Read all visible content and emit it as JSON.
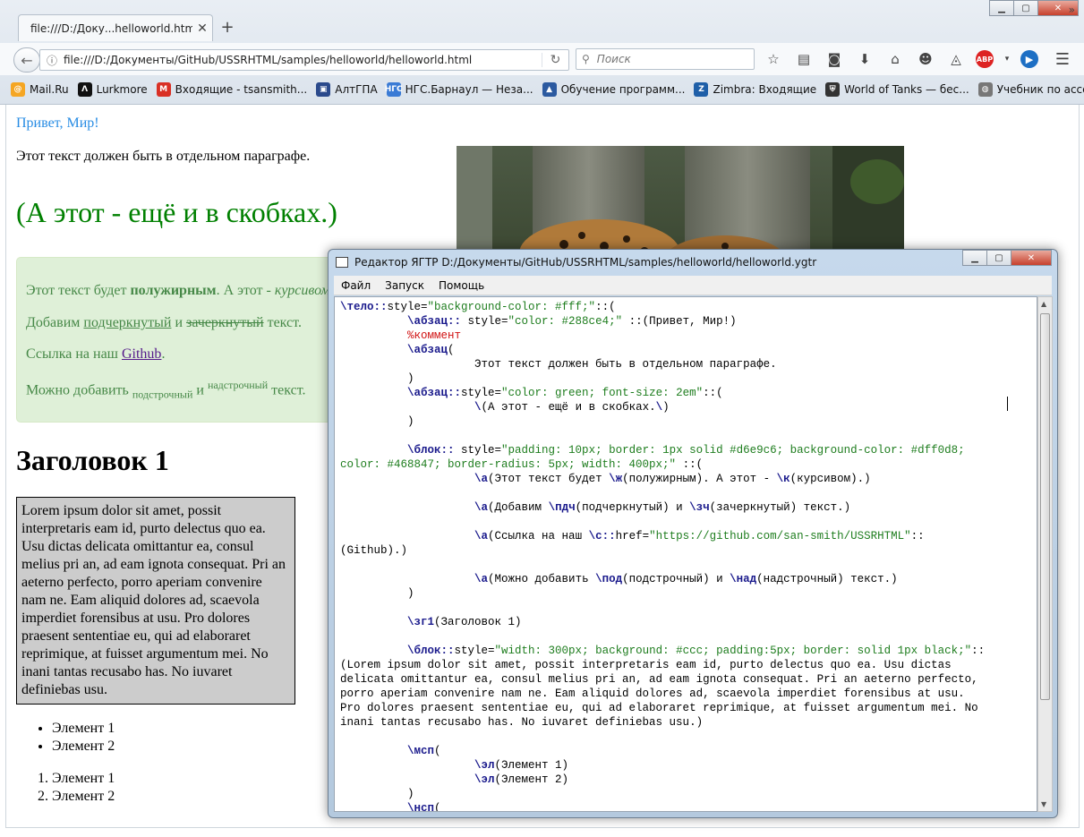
{
  "browser": {
    "tab_title": "file:///D:/Доку...helloworld.html",
    "tab_close": "✕",
    "new_tab": "+",
    "url": "file:///D:/Документы/GitHub/USSRHTML/samples/helloworld/helloworld.html",
    "search_placeholder": "Поиск",
    "window_controls": {
      "minimize": "▁",
      "maximize": "▢",
      "close": "✕"
    },
    "bookmarks": [
      {
        "label": "Mail.Ru",
        "icon": "mailru-icon",
        "color": "#f5a623",
        "glyph": "@"
      },
      {
        "label": "Lurkmore",
        "icon": "lurkmore-icon",
        "color": "#111111",
        "glyph": "Λ"
      },
      {
        "label": "Входящие - tsansmith...",
        "icon": "gmail-icon",
        "color": "#d93025",
        "glyph": "M"
      },
      {
        "label": "АлтГПА",
        "icon": "altgpa-icon",
        "color": "#2b4a8c",
        "glyph": "▣"
      },
      {
        "label": "НГС.Барнаул — Неза...",
        "icon": "ngs-icon",
        "color": "#3a7bd5",
        "glyph": "НГС"
      },
      {
        "label": "Обучение программ...",
        "icon": "obuchenie-icon",
        "color": "#2c5aa0",
        "glyph": "▲"
      },
      {
        "label": "Zimbra: Входящие",
        "icon": "zimbra-icon",
        "color": "#1f5fa8",
        "glyph": "Z"
      },
      {
        "label": "World of Tanks — бес...",
        "icon": "wot-icon",
        "color": "#333333",
        "glyph": "⛨"
      },
      {
        "label": "Учебник по ассембле...",
        "icon": "globe-icon",
        "color": "#777777",
        "glyph": "◍"
      }
    ],
    "bookmarks_more": "»"
  },
  "page": {
    "p1": "Привет, Мир!",
    "p2": "Этот текст должен быть в отдельном параграфе.",
    "p3": "(А этот - ещё и в скобках.)",
    "box": {
      "l1_a": "Этот текст будет ",
      "l1_bold": "полужирным",
      "l1_b": ". А этот - ",
      "l1_italic": "курсивом",
      "l2_a": "Добавим ",
      "l2_u": "подчеркнутый",
      "l2_b": " и ",
      "l2_s": "зачеркнутый",
      "l2_c": " текст.",
      "l3_a": "Ссылка на наш ",
      "l3_link": "Github",
      "l3_b": ".",
      "l4_a": "Можно добавить ",
      "l4_sub": "подстрочный",
      "l4_b": " и ",
      "l4_sup": "надстрочный",
      "l4_c": " текст."
    },
    "heading1": "Заголовок 1",
    "lorem": "Lorem ipsum dolor sit amet, possit interpretaris eam id, purto delectus quo ea. Usu dictas delicata omittantur ea, consul melius pri an, ad eam ignota consequat. Pri an aeterno perfecto, porro aperiam convenire nam ne. Eam aliquid dolores ad, scaevola imperdiet forensibus at usu. Pro dolores praesent sententiae eu, qui ad elaboraret reprimique, at fuisset argumentum mei. No inani tantas recusabo has. No iuvaret definiebas usu.",
    "ul_items": [
      "Элемент 1",
      "Элемент 2"
    ],
    "ol_items": [
      "Элемент 1",
      "Элемент 2"
    ]
  },
  "editor": {
    "title": "Редактор ЯГТР D:/Документы/GitHub/USSRHTML/samples/helloworld/helloworld.ygtr",
    "menu": [
      "Файл",
      "Запуск",
      "Помощь"
    ],
    "code_lines": [
      [
        [
          "kw",
          "\\тело::"
        ],
        [
          "t",
          "style="
        ],
        [
          "st",
          "\"background-color: #fff;\""
        ],
        [
          "t",
          "::("
        ]
      ],
      [
        [
          "t",
          "          "
        ],
        [
          "kw",
          "\\абзац::"
        ],
        [
          "t",
          " style="
        ],
        [
          "st",
          "\"color: #288ce4;\""
        ],
        [
          "t",
          " ::(Привет, Мир!)"
        ]
      ],
      [
        [
          "t",
          "          "
        ],
        [
          "cm",
          "%коммент"
        ]
      ],
      [
        [
          "t",
          "          "
        ],
        [
          "kw",
          "\\абзац"
        ],
        [
          "t",
          "("
        ]
      ],
      [
        [
          "t",
          "                    Этот текст должен быть в отдельном параграфе."
        ]
      ],
      [
        [
          "t",
          "          )"
        ]
      ],
      [
        [
          "t",
          "          "
        ],
        [
          "kw",
          "\\абзац::"
        ],
        [
          "t",
          "style="
        ],
        [
          "st",
          "\"color: green; font-size: 2em\""
        ],
        [
          "t",
          "::("
        ]
      ],
      [
        [
          "t",
          "                    "
        ],
        [
          "kw",
          "\\"
        ],
        [
          "t",
          "(А этот - ещё и в скобках."
        ],
        [
          "kw",
          "\\"
        ],
        [
          "t",
          ")"
        ]
      ],
      [
        [
          "t",
          "          )"
        ]
      ],
      [
        [
          "t",
          ""
        ]
      ],
      [
        [
          "t",
          "          "
        ],
        [
          "kw",
          "\\блок::"
        ],
        [
          "t",
          " style="
        ],
        [
          "st",
          "\"padding: 10px; border: 1px solid #d6e9c6; background-color: #dff0d8;"
        ]
      ],
      [
        [
          "st",
          "color: #468847; border-radius: 5px; width: 400px;\""
        ],
        [
          "t",
          " ::("
        ]
      ],
      [
        [
          "t",
          "                    "
        ],
        [
          "kw",
          "\\а"
        ],
        [
          "t",
          "(Этот текст будет "
        ],
        [
          "kw",
          "\\ж"
        ],
        [
          "t",
          "(полужирным). А этот - "
        ],
        [
          "kw",
          "\\к"
        ],
        [
          "t",
          "(курсивом).)"
        ]
      ],
      [
        [
          "t",
          ""
        ]
      ],
      [
        [
          "t",
          "                    "
        ],
        [
          "kw",
          "\\а"
        ],
        [
          "t",
          "(Добавим "
        ],
        [
          "kw",
          "\\пдч"
        ],
        [
          "t",
          "(подчеркнутый) и "
        ],
        [
          "kw",
          "\\зч"
        ],
        [
          "t",
          "(зачеркнутый) текст.)"
        ]
      ],
      [
        [
          "t",
          ""
        ]
      ],
      [
        [
          "t",
          "                    "
        ],
        [
          "kw",
          "\\а"
        ],
        [
          "t",
          "(Ссылка на наш "
        ],
        [
          "kw",
          "\\с::"
        ],
        [
          "t",
          "href="
        ],
        [
          "st",
          "\"https://github.com/san-smith/USSRHTML\""
        ],
        [
          "t",
          "::"
        ]
      ],
      [
        [
          "t",
          "(Github).)"
        ]
      ],
      [
        [
          "t",
          ""
        ]
      ],
      [
        [
          "t",
          "                    "
        ],
        [
          "kw",
          "\\а"
        ],
        [
          "t",
          "(Можно добавить "
        ],
        [
          "kw",
          "\\под"
        ],
        [
          "t",
          "(подстрочный) и "
        ],
        [
          "kw",
          "\\над"
        ],
        [
          "t",
          "(надстрочный) текст.)"
        ]
      ],
      [
        [
          "t",
          "          )"
        ]
      ],
      [
        [
          "t",
          ""
        ]
      ],
      [
        [
          "t",
          "          "
        ],
        [
          "kw",
          "\\зг1"
        ],
        [
          "t",
          "(Заголовок 1)"
        ]
      ],
      [
        [
          "t",
          ""
        ]
      ],
      [
        [
          "t",
          "          "
        ],
        [
          "kw",
          "\\блок::"
        ],
        [
          "t",
          "style="
        ],
        [
          "st",
          "\"width: 300px; background: #ccc; padding:5px; border: solid 1px black;\""
        ],
        [
          "t",
          "::"
        ]
      ],
      [
        [
          "t",
          "(Lorem ipsum dolor sit amet, possit interpretaris eam id, purto delectus quo ea. Usu dictas"
        ]
      ],
      [
        [
          "t",
          "delicata omittantur ea, consul melius pri an, ad eam ignota consequat. Pri an aeterno perfecto,"
        ]
      ],
      [
        [
          "t",
          "porro aperiam convenire nam ne. Eam aliquid dolores ad, scaevola imperdiet forensibus at usu."
        ]
      ],
      [
        [
          "t",
          "Pro dolores praesent sententiae eu, qui ad elaboraret reprimique, at fuisset argumentum mei. No"
        ]
      ],
      [
        [
          "t",
          "inani tantas recusabo has. No iuvaret definiebas usu.)"
        ]
      ],
      [
        [
          "t",
          ""
        ]
      ],
      [
        [
          "t",
          "          "
        ],
        [
          "kw",
          "\\мсп"
        ],
        [
          "t",
          "("
        ]
      ],
      [
        [
          "t",
          "                    "
        ],
        [
          "kw",
          "\\эл"
        ],
        [
          "t",
          "(Элемент 1)"
        ]
      ],
      [
        [
          "t",
          "                    "
        ],
        [
          "kw",
          "\\эл"
        ],
        [
          "t",
          "(Элемент 2)"
        ]
      ],
      [
        [
          "t",
          "          )"
        ]
      ],
      [
        [
          "t",
          "          "
        ],
        [
          "kw",
          "\\нсп"
        ],
        [
          "t",
          "("
        ]
      ]
    ]
  }
}
